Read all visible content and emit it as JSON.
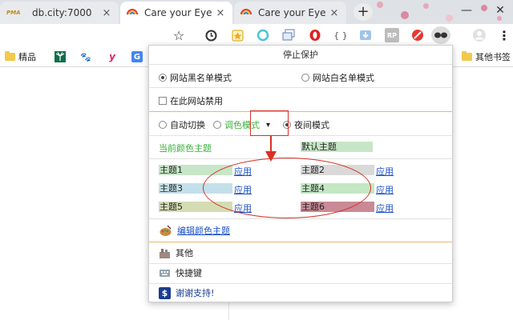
{
  "browser": {
    "tabs": [
      {
        "title": "db.city:7000",
        "favicon_text": "PMA",
        "active": false
      },
      {
        "title": "Care your Eyes",
        "active": true
      },
      {
        "title": "Care your Eyes",
        "active": false
      }
    ],
    "new_tab_symbol": "+",
    "close_symbol": "×",
    "window_controls": {
      "minimize": "—",
      "close": "✕"
    },
    "toolbar_icons": [
      "star-icon",
      "history-icon",
      "bookmark-star-icon",
      "circle-icon",
      "window-icon",
      "opera-icon",
      "json-icon",
      "download-icon",
      "rp-icon",
      "no-icon",
      "care-your-eyes-icon",
      "profile-icon",
      "menu-icon"
    ],
    "toolbar_text": {
      "star": "☆",
      "json": "{ }",
      "rp": "RP",
      "menu": "⋮"
    }
  },
  "bookmarks": {
    "items": [
      {
        "label": "精品",
        "icon": "folder-icon"
      },
      {
        "label": "",
        "icon": "palm-icon"
      },
      {
        "label": "",
        "icon": "paw-icon",
        "glyph": "🐾"
      },
      {
        "label": "",
        "icon": "y-icon",
        "glyph": "y"
      },
      {
        "label": "",
        "icon": "google-icon",
        "glyph": "G"
      }
    ],
    "other_label": "其他书签"
  },
  "popup": {
    "header": "停止保护",
    "blacklist_label": "网站黑名单模式",
    "whitelist_label": "网站白名单模式",
    "disable_label": "在此网站禁用",
    "auto_switch_label": "自动切换",
    "color_mode_label": "调色模式",
    "dropdown_arrow": "▾",
    "night_mode_label": "夜间模式",
    "current_theme_label": "当前颜色主题",
    "default_theme_label": "默认主题",
    "themes": [
      {
        "name": "主题1",
        "color": "#c7e6c7",
        "apply": "应用"
      },
      {
        "name": "主题2",
        "color": "#d9d9d9",
        "apply": "应用"
      },
      {
        "name": "主题3",
        "color": "#c3e0ea",
        "apply": "应用"
      },
      {
        "name": "主题4",
        "color": "#c3e8c3",
        "apply": "应用"
      },
      {
        "name": "主题5",
        "color": "#d4dcb4",
        "apply": "应用"
      },
      {
        "name": "主题6",
        "color": "#c98a96",
        "apply": "应用"
      }
    ],
    "edit_theme_label": "编辑颜色主题",
    "other_label": "其他",
    "shortcut_label": "快捷键",
    "thanks_label": "谢谢支持!",
    "colors": {
      "accent_green": "#3cae3c",
      "link_blue": "#1a4fc8",
      "annotation_red": "#d93025",
      "divider_orange": "#e8b86c"
    }
  }
}
